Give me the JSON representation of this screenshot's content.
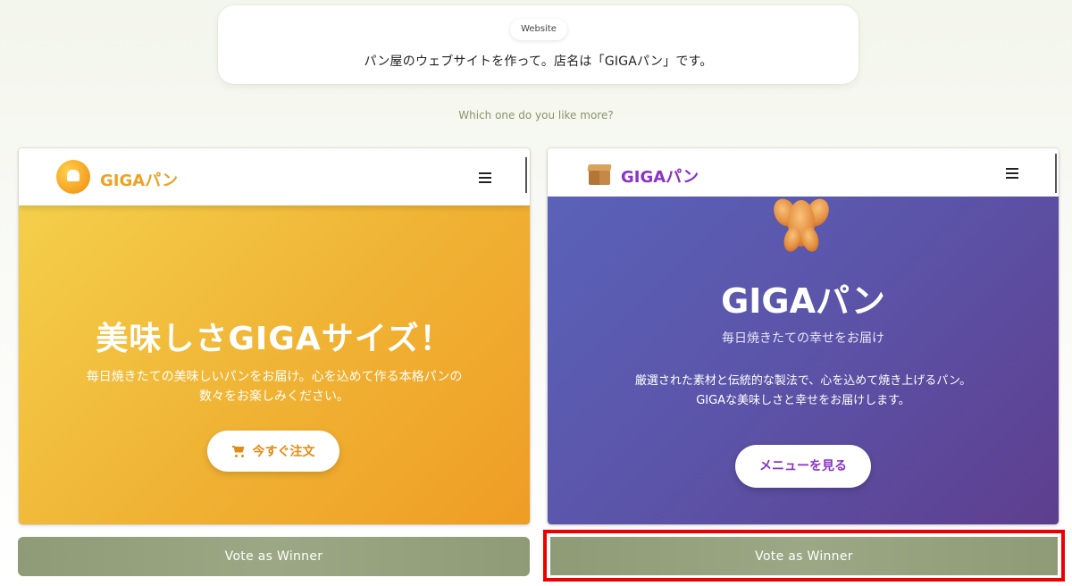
{
  "prompt": {
    "tag": "Website",
    "text": "パン屋のウェブサイトを作って。店名は「GIGAパン」です。"
  },
  "question": "Which one do you like more?",
  "left": {
    "brand": "GIGAパン",
    "hero_title": "美味しさGIGAサイズ！",
    "hero_desc_line1": "毎日焼きたての美味しいパンをお届け。心を込めて作る本格パンの",
    "hero_desc_line2": "数々をお楽しみください。",
    "cta_label": "今すぐ注文",
    "colors": {
      "brand": "#f0a124",
      "hero_start": "#f4cf4b",
      "hero_end": "#ef9d24"
    }
  },
  "right": {
    "brand": "GIGAパン",
    "hero_title": "GIGAパン",
    "hero_subtitle": "毎日焼きたての幸せをお届け",
    "hero_desc_line1": "厳選された素材と伝統的な製法で、心を込めて焼き上げるパン。",
    "hero_desc_line2": "GIGAな美味しさと幸せをお届けします。",
    "cta_label": "メニューを見る",
    "colors": {
      "brand": "#8a33c4",
      "hero_start": "#5a62b8",
      "hero_end": "#5e3e8e"
    }
  },
  "vote": {
    "left_label": "Vote as Winner",
    "right_label": "Vote as Winner",
    "highlight_color": "#ee0000"
  },
  "icons": {
    "left_logo": "bread-icon",
    "left_menu": "hamburger-menu-icon",
    "left_cta": "cart-icon",
    "right_logo": "box-icon",
    "right_menu": "hamburger-menu-icon",
    "right_hero": "croissant-icon"
  }
}
